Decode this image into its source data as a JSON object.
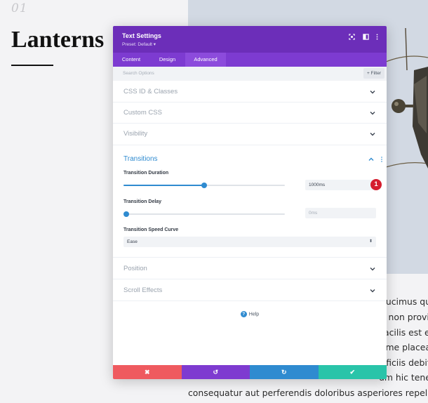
{
  "page": {
    "number": "01",
    "heading": "Lanterns",
    "body_lines": [
      "ducimus qu",
      "e non provic",
      "acilis est et",
      "ime placea",
      "fficiis debit",
      "um hic tene",
      "consequatur aut perferendis doloribus asperiores repellat."
    ]
  },
  "modal": {
    "title": "Text Settings",
    "preset": "Preset: Default ▾",
    "header_icons": [
      "fullscreen-icon",
      "split-view-icon",
      "more-icon"
    ],
    "tabs": [
      {
        "label": "Content",
        "active": false
      },
      {
        "label": "Design",
        "active": false
      },
      {
        "label": "Advanced",
        "active": true
      }
    ],
    "search": {
      "placeholder": "Search Options",
      "filter_label": "+ Filter"
    },
    "sections": {
      "css_id": "CSS ID & Classes",
      "custom_css": "Custom CSS",
      "visibility": "Visibility",
      "transitions": "Transitions",
      "position": "Position",
      "scroll_effects": "Scroll Effects"
    },
    "transitions": {
      "duration_label": "Transition Duration",
      "duration_value": "1000ms",
      "duration_level": 0.5,
      "delay_label": "Transition Delay",
      "delay_placeholder": "0ms",
      "delay_level": 0,
      "curve_label": "Transition Speed Curve",
      "curve_value": "Ease"
    },
    "help_label": "Help",
    "footer": {
      "cancel_icon": "✖",
      "undo_icon": "↺",
      "redo_icon": "↻",
      "save_icon": "✔"
    }
  },
  "annotation": {
    "badge": "1"
  },
  "colors": {
    "header_purple": "#6c2eb9",
    "tab_purple": "#7d3bd1",
    "accent_blue": "#2f8bd0",
    "cancel_red": "#ef5a5f",
    "undo_purple": "#7e3bd0",
    "redo_blue": "#2f8bd0",
    "save_green": "#29c4a9",
    "badge_red": "#d51d2e"
  }
}
